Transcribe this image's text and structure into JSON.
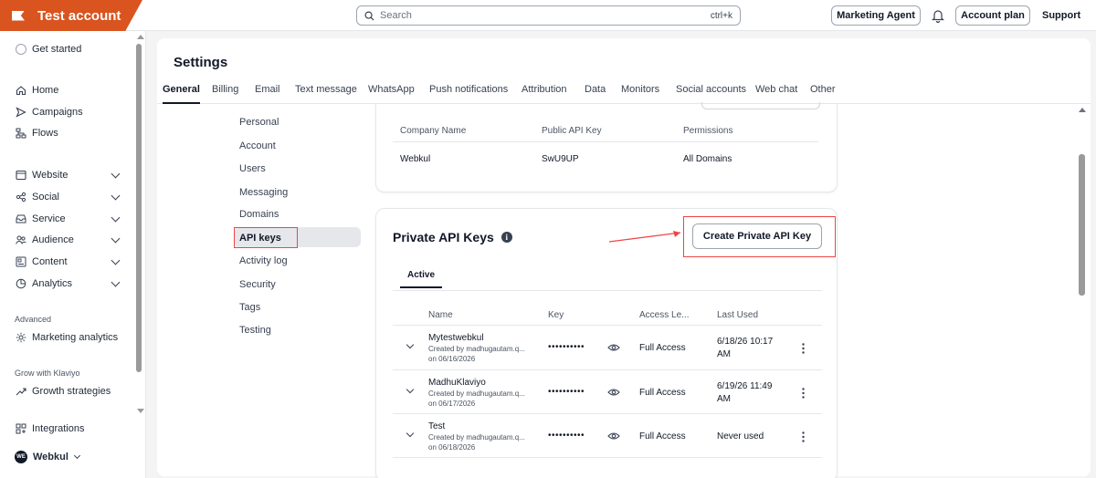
{
  "app": {
    "account_name": "Test account"
  },
  "search": {
    "placeholder": "Search",
    "shortcut": "ctrl+k"
  },
  "topbar": {
    "marketing_agent": "Marketing Agent",
    "account_plan": "Account plan",
    "support": "Support"
  },
  "sidebar": {
    "get_started": "Get started",
    "items": [
      {
        "label": "Home",
        "icon": "home-icon"
      },
      {
        "label": "Campaigns",
        "icon": "send-icon"
      },
      {
        "label": "Flows",
        "icon": "flow-icon"
      },
      {
        "label": "Website",
        "icon": "website-icon"
      },
      {
        "label": "Social",
        "icon": "social-icon"
      },
      {
        "label": "Service",
        "icon": "inbox-icon"
      },
      {
        "label": "Audience",
        "icon": "audience-icon"
      },
      {
        "label": "Content",
        "icon": "content-icon"
      },
      {
        "label": "Analytics",
        "icon": "analytics-icon"
      }
    ],
    "advanced_label": "Advanced",
    "marketing_analytics": "Marketing analytics",
    "grow_label": "Grow with Klaviyo",
    "growth_strategies": "Growth strategies",
    "integrations": "Integrations",
    "account_initials": "WE",
    "account": "Webkul"
  },
  "settings": {
    "title": "Settings",
    "tabs": [
      "General",
      "Billing",
      "Email",
      "Text message",
      "WhatsApp",
      "Push notifications",
      "Attribution",
      "Data",
      "Monitors",
      "Social accounts",
      "Web chat",
      "Other"
    ],
    "subnav": [
      "Personal",
      "Account",
      "Users",
      "Messaging",
      "Domains",
      "API keys",
      "Activity log",
      "Security",
      "Tags",
      "Testing"
    ]
  },
  "public_keys": {
    "headers": [
      "Company Name",
      "Public API Key",
      "Permissions"
    ],
    "row": [
      "Webkul",
      "SwU9UP",
      "All Domains"
    ]
  },
  "private_keys": {
    "title": "Private API Keys",
    "info_glyph": "i",
    "create_button": "Create Private API Key",
    "active_tab": "Active",
    "headers": [
      "Name",
      "Key",
      "Access Le...",
      "Last Used"
    ],
    "rows": [
      {
        "name": "Mytestwebkul",
        "created_by": "Created by madhugautam.q...",
        "created_on": "on 06/16/2026",
        "key": "••••••••••",
        "access": "Full Access",
        "last_used_1": "6/18/26 10:17",
        "last_used_2": "AM"
      },
      {
        "name": "MadhuKlaviyo",
        "created_by": "Created by madhugautam.q...",
        "created_on": "on 06/17/2026",
        "key": "••••••••••",
        "access": "Full Access",
        "last_used_1": "6/19/26 11:49",
        "last_used_2": "AM"
      },
      {
        "name": "Test",
        "created_by": "Created by madhugautam.q...",
        "created_on": "on 06/18/2026",
        "key": "••••••••••",
        "access": "Full Access",
        "last_used_1": "Never used",
        "last_used_2": ""
      }
    ]
  },
  "colors": {
    "brand": "#d9541e",
    "highlight": "#ef4444"
  }
}
